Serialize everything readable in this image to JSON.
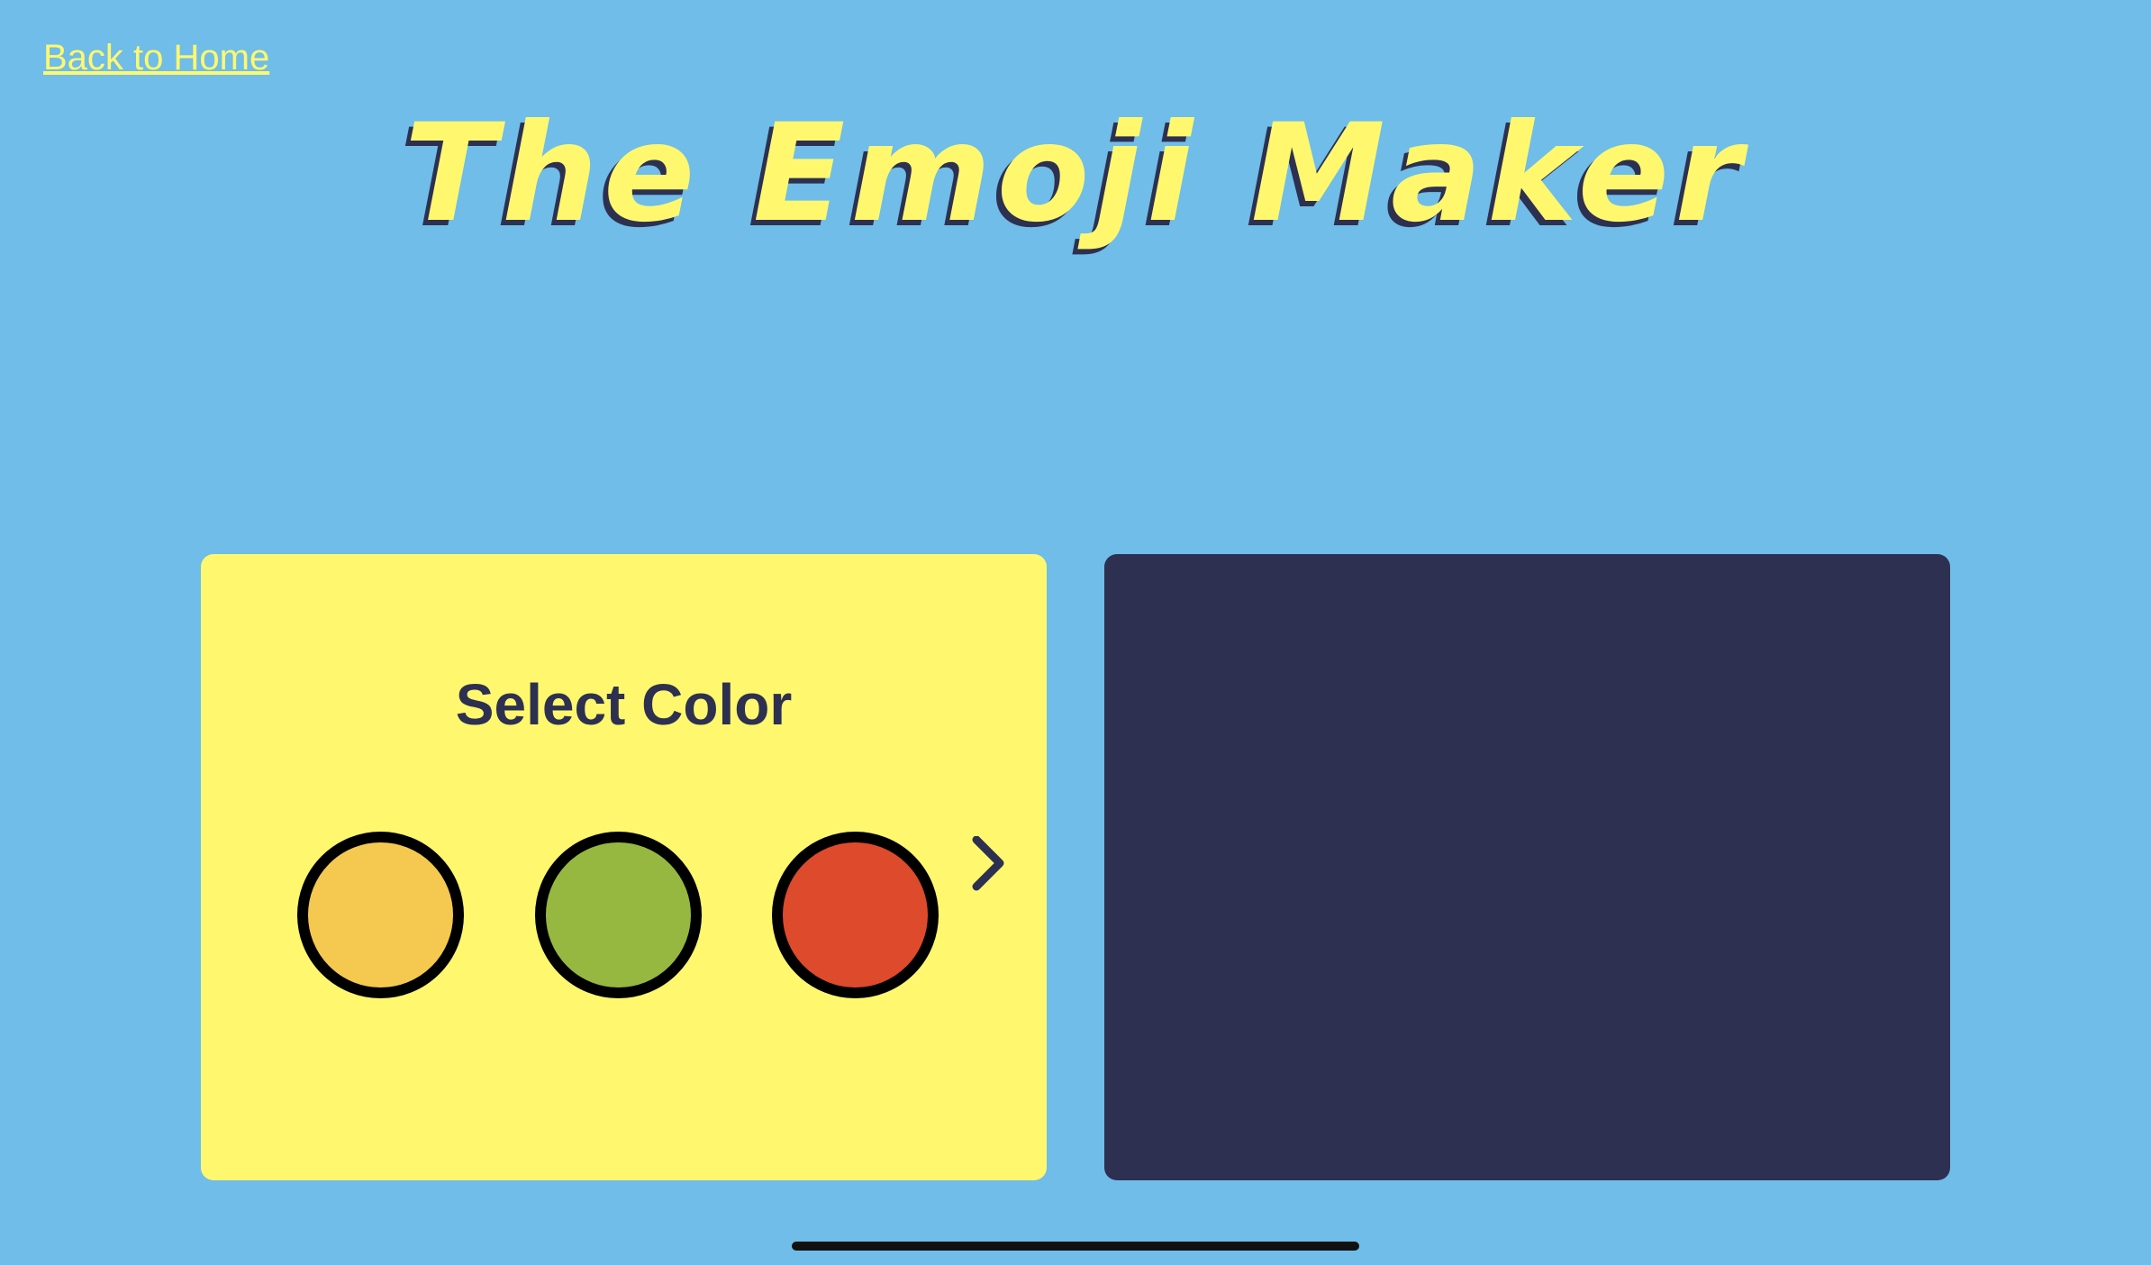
{
  "nav": {
    "back_label": "Back to Home"
  },
  "header": {
    "title": "The Emoji Maker"
  },
  "color_picker": {
    "heading": "Select Color",
    "swatches": [
      {
        "name": "yellow",
        "color": "#F5C94F"
      },
      {
        "name": "green",
        "color": "#96B840"
      },
      {
        "name": "red",
        "color": "#DE4A2C"
      }
    ],
    "next_icon": "chevron-right-icon"
  },
  "colors": {
    "background": "#6FBDE8",
    "accent_yellow": "#FFF86E",
    "dark_navy": "#2D3050",
    "swatch_border": "#000000",
    "home_indicator": "#111111"
  }
}
